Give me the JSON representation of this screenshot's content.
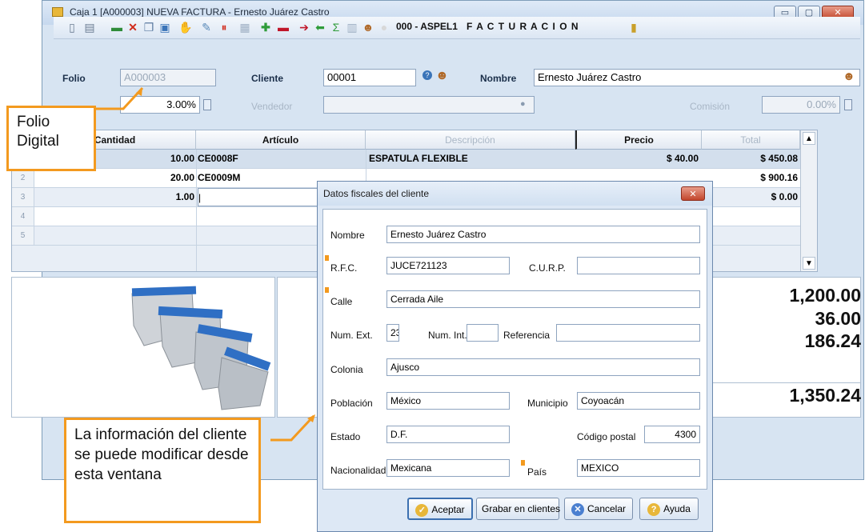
{
  "window": {
    "title": "Caja 1 [A000003] NUEVA FACTURA - Ernesto Juárez Castro",
    "min": "▭",
    "max": "▢",
    "close": "✕"
  },
  "toolbar": {
    "code": "000 - ASPEL1",
    "mode": "F A C T U R A C I O N",
    "icons": [
      "new-doc-icon",
      "doc-icon",
      "cash-icon",
      "delete-icon",
      "copy-icon",
      "image-icon",
      "handshake-icon",
      "pin-icon",
      "stop-icon",
      "grid-icon",
      "add-icon",
      "remove-icon",
      "arrow-right-icon",
      "arrow-left-icon",
      "sigma-icon",
      "chart-icon",
      "user-icon",
      "bulb-icon"
    ]
  },
  "form": {
    "folio_label": "Folio",
    "folio_value": "A000003",
    "cliente_label": "Cliente",
    "cliente_value": "00001",
    "nombre_label": "Nombre",
    "nombre_value": "Ernesto Juárez Castro",
    "desc_value": "3.00%",
    "vendedor_label": "Vendedor",
    "comision_label": "Comisión",
    "comision_value": "0.00%"
  },
  "grid": {
    "headers": [
      "Cantidad",
      "Artículo",
      "Descripción",
      "Precio",
      "Total"
    ],
    "rows": [
      {
        "num": "1",
        "cantidad": "10.00",
        "articulo": "CE0008F",
        "descripcion": "ESPATULA FLEXIBLE",
        "precio": "$ 40.00",
        "total": "$ 450.08"
      },
      {
        "num": "2",
        "cantidad": "20.00",
        "articulo": "CE0009M",
        "descripcion": "",
        "precio": "",
        "total": "$ 900.16"
      },
      {
        "num": "3",
        "cantidad": "1.00",
        "articulo": "",
        "descripcion": "",
        "precio": "",
        "total": "$ 0.00"
      },
      {
        "num": "4",
        "cantidad": "",
        "articulo": "",
        "descripcion": "",
        "precio": "",
        "total": ""
      },
      {
        "num": "5",
        "cantidad": "",
        "articulo": "",
        "descripcion": "",
        "precio": "",
        "total": ""
      }
    ]
  },
  "totals": {
    "subtotal": "1,200.00",
    "descuento": "36.00",
    "impuesto": "186.24",
    "total": "1,350.24"
  },
  "callouts": {
    "folio": "Folio\nDigital",
    "cliente": "La información del cliente se puede modificar desde esta ventana"
  },
  "dialog": {
    "title": "Datos fiscales del cliente",
    "nombre_label": "Nombre",
    "nombre": "Ernesto Juárez Castro",
    "rfc_label": "R.F.C.",
    "rfc": "JUCE721123",
    "curp_label": "C.U.R.P.",
    "curp": "",
    "calle_label": "Calle",
    "calle": "Cerrada Aile",
    "numext_label": "Num. Ext.",
    "numext": "23",
    "numint_label": "Num. Int.",
    "numint": "",
    "referencia_label": "Referencia",
    "referencia": "",
    "colonia_label": "Colonia",
    "colonia": "Ajusco",
    "poblacion_label": "Población",
    "poblacion": "México",
    "municipio_label": "Municipio",
    "municipio": "Coyoacán",
    "estado_label": "Estado",
    "estado": "D.F.",
    "cp_label": "Código postal",
    "cp": "4300",
    "nacionalidad_label": "Nacionalidad",
    "nacionalidad": "Mexicana",
    "pais_label": "País",
    "pais": "MEXICO",
    "btn_aceptar": "Aceptar",
    "btn_grabar": "Grabar en clientes",
    "btn_cancelar": "Cancelar",
    "btn_ayuda": "Ayuda",
    "close": "✕"
  }
}
